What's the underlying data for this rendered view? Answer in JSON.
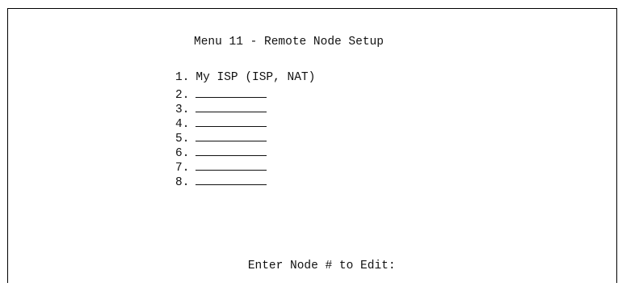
{
  "screen": {
    "title": "Menu 11 - Remote Node Setup",
    "items": [
      {
        "number": "1.",
        "label": "My ISP (ISP, NAT)"
      },
      {
        "number": "2.",
        "label": ""
      },
      {
        "number": "3.",
        "label": ""
      },
      {
        "number": "4.",
        "label": ""
      },
      {
        "number": "5.",
        "label": ""
      },
      {
        "number": "6.",
        "label": ""
      },
      {
        "number": "7.",
        "label": ""
      },
      {
        "number": "8.",
        "label": ""
      }
    ],
    "prompt": "Enter Node # to Edit:"
  }
}
